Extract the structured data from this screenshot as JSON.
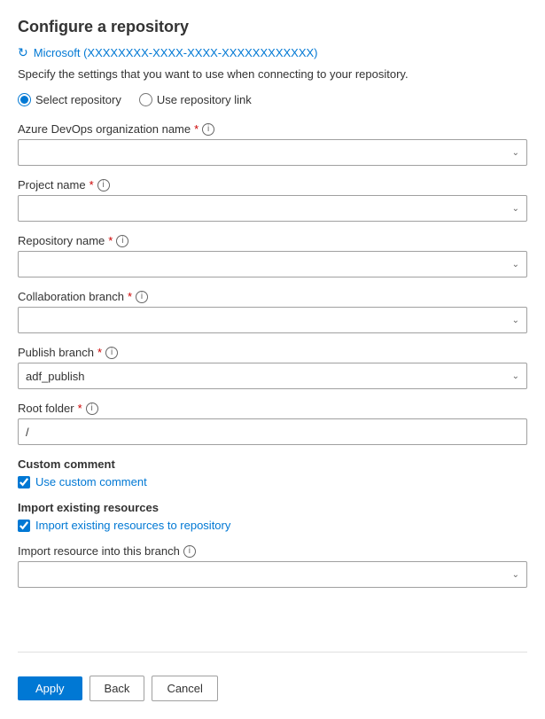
{
  "page": {
    "title": "Configure a repository",
    "description": "Specify the settings that you want to use when connecting to your repository.",
    "tenant": "Microsoft (XXXXXXXX-XXXX-XXXX-XXXXXXXXXXXX)",
    "tenant_icon": "↻"
  },
  "radio_group": {
    "option1_label": "Select repository",
    "option2_label": "Use repository link",
    "selected": "select"
  },
  "fields": {
    "org_name_label": "Azure DevOps organization name",
    "org_name_info": "i",
    "project_name_label": "Project name",
    "project_name_info": "i",
    "repo_name_label": "Repository name",
    "repo_name_info": "i",
    "collab_branch_label": "Collaboration branch",
    "collab_branch_info": "i",
    "publish_branch_label": "Publish branch",
    "publish_branch_info": "i",
    "publish_branch_value": "adf_publish",
    "root_folder_label": "Root folder",
    "root_folder_info": "i",
    "root_folder_value": "/"
  },
  "custom_comment": {
    "heading": "Custom comment",
    "checkbox_label": "Use custom comment",
    "checked": true
  },
  "import_resources": {
    "heading": "Import existing resources",
    "checkbox_label": "Import existing resources to repository",
    "checked": true
  },
  "import_branch": {
    "label": "Import resource into this branch",
    "info": "i",
    "value": ""
  },
  "footer": {
    "apply_label": "Apply",
    "back_label": "Back",
    "cancel_label": "Cancel"
  }
}
